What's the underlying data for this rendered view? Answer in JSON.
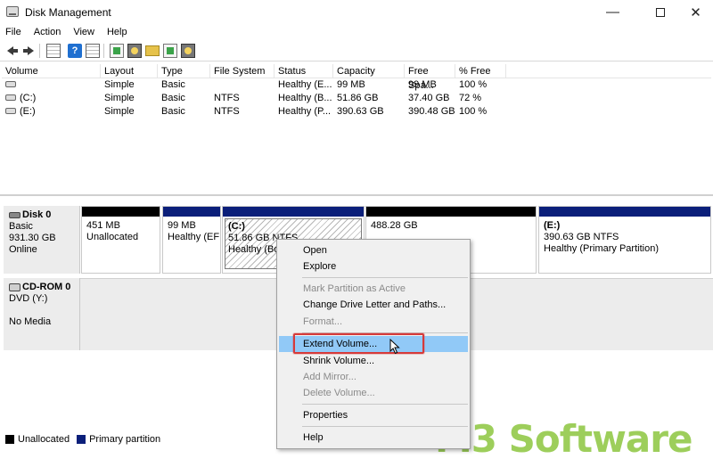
{
  "window": {
    "title": "Disk Management",
    "min_glyph": "—",
    "close_glyph": "✕"
  },
  "menu": [
    "File",
    "Action",
    "View",
    "Help"
  ],
  "toolbar": {
    "icons": [
      "back-arrow-icon",
      "forward-arrow-icon",
      "properties-grid-icon",
      "help-icon",
      "refresh-icon",
      "settings-icon",
      "open-folder-icon",
      "disk-icon"
    ],
    "help_glyph": "?"
  },
  "volume_table": {
    "columns": [
      "Volume",
      "Layout",
      "Type",
      "File System",
      "Status",
      "Capacity",
      "Free Spa...",
      "% Free"
    ],
    "rows": [
      {
        "volume": "",
        "layout": "Simple",
        "type": "Basic",
        "fs": "",
        "status": "Healthy (E...",
        "capacity": "99 MB",
        "free": "99 MB",
        "pct": "100 %"
      },
      {
        "volume": "(C:)",
        "layout": "Simple",
        "type": "Basic",
        "fs": "NTFS",
        "status": "Healthy (B...",
        "capacity": "51.86 GB",
        "free": "37.40 GB",
        "pct": "72 %"
      },
      {
        "volume": "(E:)",
        "layout": "Simple",
        "type": "Basic",
        "fs": "NTFS",
        "status": "Healthy (P...",
        "capacity": "390.63 GB",
        "free": "390.48 GB",
        "pct": "100 %"
      }
    ]
  },
  "disks": {
    "disk0": {
      "name": "Disk 0",
      "type": "Basic",
      "size": "931.30 GB",
      "state": "Online"
    },
    "cdrom0": {
      "name": "CD-ROM 0",
      "type": "DVD (Y:)",
      "media": "No Media"
    }
  },
  "partitions": [
    {
      "label": "",
      "size": "451 MB",
      "desc": "Unallocated",
      "bar": "black"
    },
    {
      "label": "",
      "size": "99 MB",
      "desc": "Healthy (EFI",
      "bar": "blue"
    },
    {
      "label": "(C:)",
      "size": "51.86 GB NTFS",
      "desc": "Healthy (Bo",
      "bar": "blue"
    },
    {
      "label": "",
      "size": "488.28 GB",
      "desc": "",
      "bar": "black"
    },
    {
      "label": "(E:)",
      "size": "390.63 GB NTFS",
      "desc": "Healthy (Primary Partition)",
      "bar": "blue"
    }
  ],
  "legend": {
    "unallocated": "Unallocated",
    "primary": "Primary partition"
  },
  "context_menu": {
    "open": "Open",
    "explore": "Explore",
    "mark_active": "Mark Partition as Active",
    "change_letter": "Change Drive Letter and Paths...",
    "format": "Format...",
    "extend": "Extend Volume...",
    "shrink": "Shrink Volume...",
    "add_mirror": "Add Mirror...",
    "delete": "Delete Volume...",
    "properties": "Properties",
    "help": "Help"
  },
  "watermark": "M3 Software"
}
